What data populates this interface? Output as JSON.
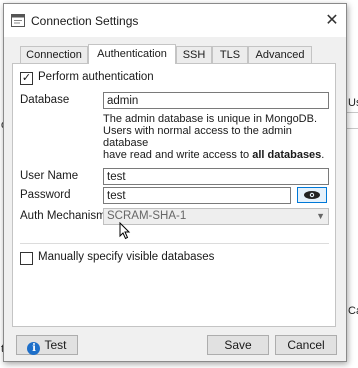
{
  "window": {
    "title": "Connection Settings",
    "close_glyph": "✕"
  },
  "tabs": [
    {
      "label": "Connection",
      "active": false
    },
    {
      "label": "Authentication",
      "active": true
    },
    {
      "label": "SSH",
      "active": false
    },
    {
      "label": "TLS",
      "active": false
    },
    {
      "label": "Advanced",
      "active": false
    }
  ],
  "auth": {
    "perform_label": "Perform authentication",
    "perform_checked": true,
    "database_label": "Database",
    "database_value": "admin",
    "help_text_1": "The admin database is unique in MongoDB.",
    "help_text_2": "Users with normal access to the admin database",
    "help_text_3": "have read and write access to ",
    "help_text_bold": "all databases",
    "help_text_end": ".",
    "username_label": "User Name",
    "username_value": "test",
    "password_label": "Password",
    "password_value": "test",
    "mechanism_label": "Auth Mechanism",
    "mechanism_value": "SCRAM-SHA-1",
    "visible_dbs_label": "Manually specify visible databases",
    "visible_dbs_checked": false
  },
  "footer": {
    "test_label": "Test",
    "save_label": "Save",
    "cancel_label": "Cancel"
  },
  "background": {
    "label_us": "Us",
    "label_can": "Car",
    "label_o": "o",
    "label_t": "t"
  },
  "colors": {
    "accent": "#0078d7",
    "info_icon": "#1e6fc9"
  }
}
